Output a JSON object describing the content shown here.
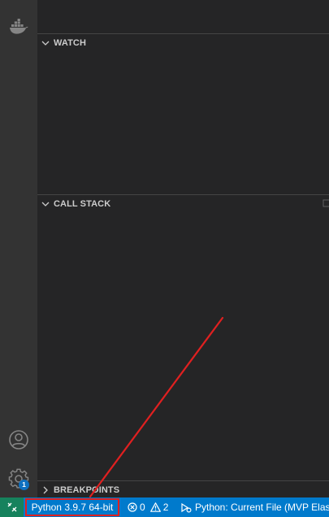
{
  "sidebar": {
    "sections": [
      {
        "label": "WATCH",
        "expanded": true
      },
      {
        "label": "CALL STACK",
        "expanded": true
      },
      {
        "label": "BREAKPOINTS",
        "expanded": false
      }
    ]
  },
  "activity_bar": {
    "top_icon": "docker-icon",
    "bottom_icons": [
      "account-icon",
      "gear-icon"
    ],
    "manage_badge": "1"
  },
  "status_bar": {
    "remote_icon": "remote-icon",
    "interpreter": "Python 3.9.7 64-bit",
    "errors_count": "0",
    "warnings_count": "2",
    "debug_config": "Python: Current File (MVP Elasti"
  },
  "colors": {
    "status_bar_bg": "#007acc",
    "remote_bg": "#16825d",
    "sidebar_bg": "#252526",
    "activity_bar_bg": "#333333",
    "highlight_box": "#e02020",
    "annotation_arrow": "#e02020"
  }
}
